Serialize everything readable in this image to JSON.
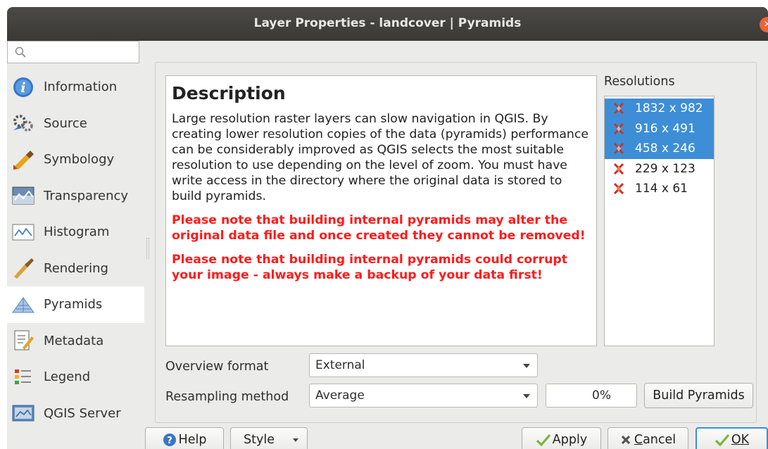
{
  "window": {
    "title": "Layer Properties - landcover | Pyramids",
    "close_glyph": "×"
  },
  "search": {
    "placeholder": ""
  },
  "sidebar": {
    "items": [
      {
        "label": "Information",
        "icon": "information-icon"
      },
      {
        "label": "Source",
        "icon": "source-icon"
      },
      {
        "label": "Symbology",
        "icon": "symbology-icon"
      },
      {
        "label": "Transparency",
        "icon": "transparency-icon"
      },
      {
        "label": "Histogram",
        "icon": "histogram-icon"
      },
      {
        "label": "Rendering",
        "icon": "rendering-icon"
      },
      {
        "label": "Pyramids",
        "icon": "pyramids-icon",
        "selected": true
      },
      {
        "label": "Metadata",
        "icon": "metadata-icon"
      },
      {
        "label": "Legend",
        "icon": "legend-icon"
      },
      {
        "label": "QGIS Server",
        "icon": "qgis-server-icon"
      }
    ]
  },
  "description": {
    "title": "Description",
    "body": "Large resolution raster layers can slow navigation in QGIS. By creating lower resolution copies of the data (pyramids) performance can be considerably improved as QGIS selects the most suitable resolution to use depending on the level of zoom. You must have write access in the directory where the original data is stored to build pyramids.",
    "warning1": "Please note that building internal pyramids may alter the original data file and once created they cannot be removed!",
    "warning2": "Please note that building internal pyramids could corrupt your image - always make a backup of your data first!"
  },
  "resolutions": {
    "label": "Resolutions",
    "items": [
      {
        "value": "1832 x 982",
        "selected": true
      },
      {
        "value": "916 x 491",
        "selected": true
      },
      {
        "value": "458 x 246",
        "selected": true
      },
      {
        "value": "229 x 123",
        "selected": false
      },
      {
        "value": "114 x 61",
        "selected": false
      }
    ]
  },
  "overview_format": {
    "label": "Overview format",
    "value": "External"
  },
  "resampling": {
    "label": "Resampling method",
    "value": "Average"
  },
  "progress": {
    "text": "0%"
  },
  "build_button": {
    "label": "Build Pyramids"
  },
  "footer": {
    "help": "Help",
    "style": "Style",
    "apply": "Apply",
    "cancel_c": "C",
    "cancel_rest": "ancel",
    "ok": "OK"
  },
  "colors": {
    "selection": "#3d8ed6",
    "warning": "#ff1a1a",
    "titlebar": "#3f3e3a",
    "close": "#e9643a"
  }
}
